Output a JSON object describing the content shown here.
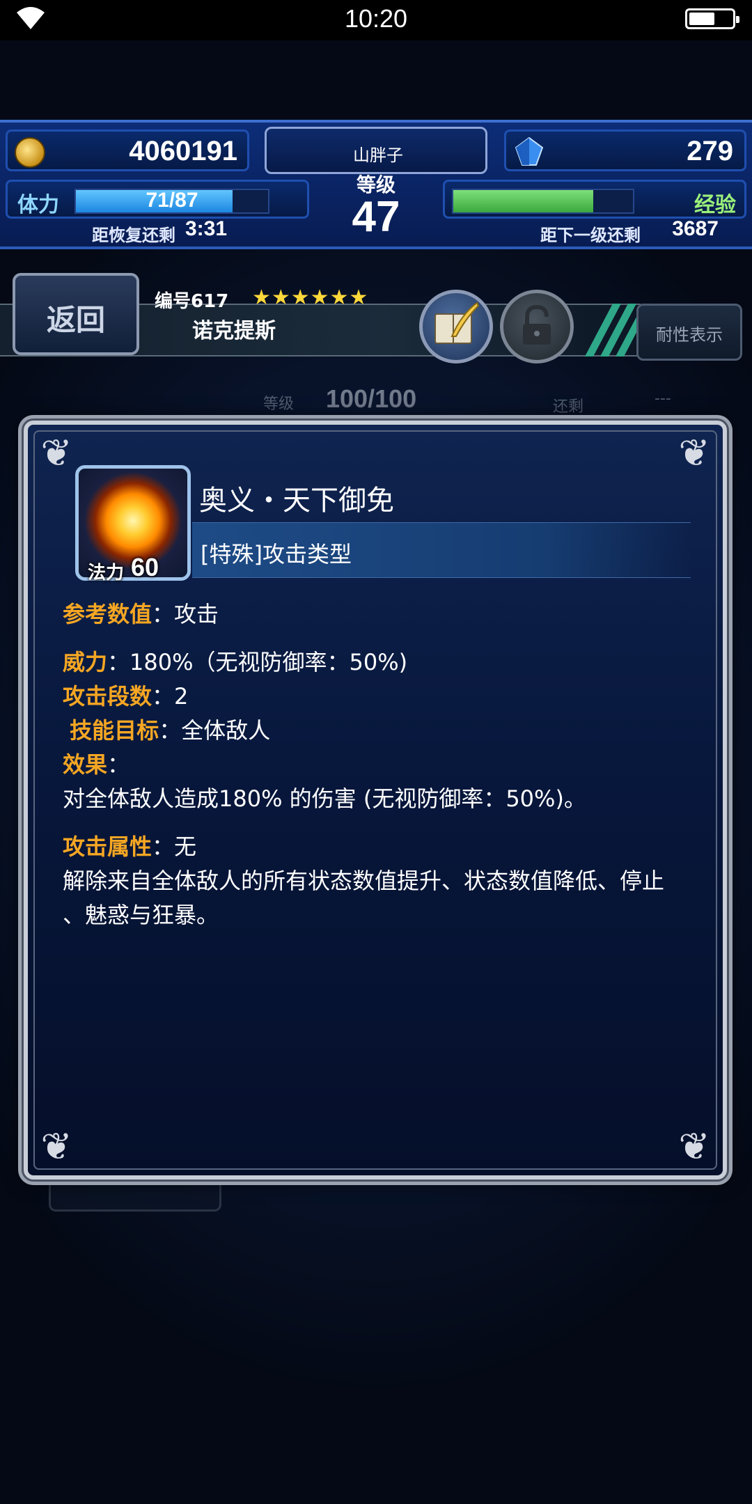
{
  "status_bar": {
    "time": "10:20"
  },
  "hud": {
    "gil": "4060191",
    "gems": "279",
    "player_name": "山胖子",
    "rank_label": "等级",
    "rank": "47",
    "stamina_label": "体力",
    "stamina_text": "71/87",
    "stamina_fraction": 0.816,
    "recover_label": "距恢复还剩",
    "recover_time": "3:31",
    "exp_label": "经验",
    "exp_fraction": 0.78,
    "next_level_label": "距下一级还剩",
    "next_level_value": "3687",
    "icons": {
      "gil": "gil-coin-icon",
      "gem": "lapis-gem-icon"
    }
  },
  "unit": {
    "back_label": "返回",
    "number": "编号617",
    "stars": "★★★★★★",
    "name": "诺克提斯",
    "resist_label": "耐性表示",
    "icons": {
      "quill": "quill-book-icon",
      "lock": "lock-icon"
    }
  },
  "background_row": {
    "level_label": "等级",
    "level_value": "100/100",
    "remain_label": "还剩",
    "remain_value": "---"
  },
  "skill": {
    "name": "奥义・天下御免",
    "type": "[特殊]攻击类型",
    "mp_label": "法力",
    "mp_value": "60",
    "ref_key": "参考数值",
    "ref_val": "：攻击",
    "power_key": "威力",
    "power_val": "：180%（无视防御率：50%)",
    "hits_key": "攻击段数",
    "hits_val": "：2",
    "target_key": "技能目标",
    "target_val": "：全体敌人",
    "effect_key": "效果",
    "effect_val": "：",
    "effect_line": "对全体敌人造成180% 的伤害 (无视防御率：50%)。",
    "element_key": "攻击属性",
    "element_val": "：无",
    "extra_line_1": "解除来自全体敌人的所有状态数值提升、状态数值降低、停止",
    "extra_line_2": "、魅惑与狂暴。"
  },
  "colors": {
    "key_text": "#f5a623",
    "stamina_bar": "#1d86e0",
    "exp_bar": "#3aa83c",
    "stars": "#ffd83a"
  }
}
